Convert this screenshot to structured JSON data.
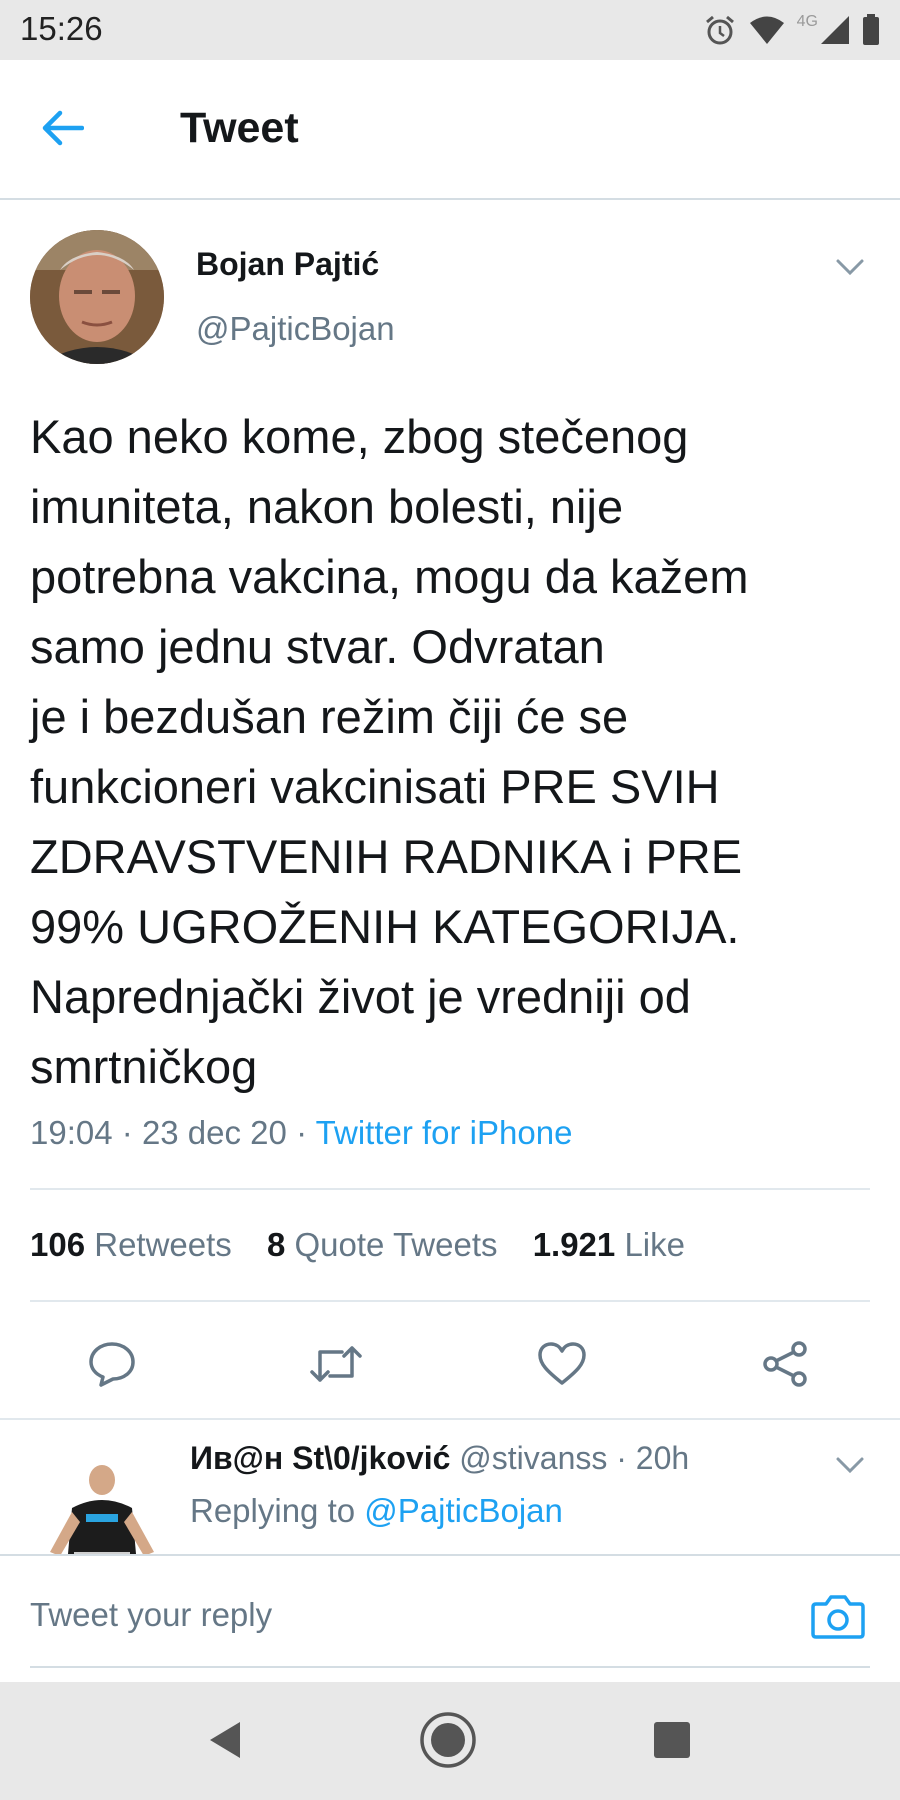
{
  "status_bar": {
    "time": "15:26",
    "network_label": "4G",
    "icons": [
      "alarm-icon",
      "wifi-icon",
      "signal-icon",
      "battery-icon"
    ]
  },
  "header": {
    "title": "Tweet",
    "back_icon": "back-arrow-icon"
  },
  "tweet": {
    "author_name": "Bojan Pajtić",
    "author_handle": "@PajticBojan",
    "text_lines": [
      "Kao neko kome, zbog stečenog",
      "imuniteta, nakon bolesti, nije",
      "potrebna vakcina, mogu da kažem",
      "samo jednu stvar. Odvratan",
      "je i bezdušan režim čiji će se",
      "funkcioneri vakcinisati PRE SVIH",
      "ZDRAVSTVENIH RADNIKA i PRE",
      "99% UGROŽENIH KATEGORIJA.",
      "Naprednjački život je vredniji od",
      "smrtničkog"
    ],
    "time": "19:04",
    "date": "23 dec 20",
    "separator": "·",
    "source": "Twitter for iPhone",
    "stats": {
      "retweets_count": "106",
      "retweets_label": "Retweets",
      "quotes_count": "8",
      "quotes_label": "Quote Tweets",
      "likes_count": "1.921",
      "likes_label": "Like"
    },
    "actions": [
      "reply-icon",
      "retweet-icon",
      "like-icon",
      "share-icon"
    ]
  },
  "reply": {
    "name": "Ив@н St\\0/jković",
    "handle": "@stivanss",
    "age": "20h",
    "replying_prefix": "Replying to",
    "replying_to": "@PajticBojan"
  },
  "compose": {
    "placeholder": "Tweet your reply",
    "camera_icon": "camera-icon"
  },
  "colors": {
    "accent": "#1da1f2",
    "secondary_text": "#657786",
    "primary_text": "#14171a",
    "divider": "#e1e8ed",
    "system_bar": "#e8e8e8"
  }
}
